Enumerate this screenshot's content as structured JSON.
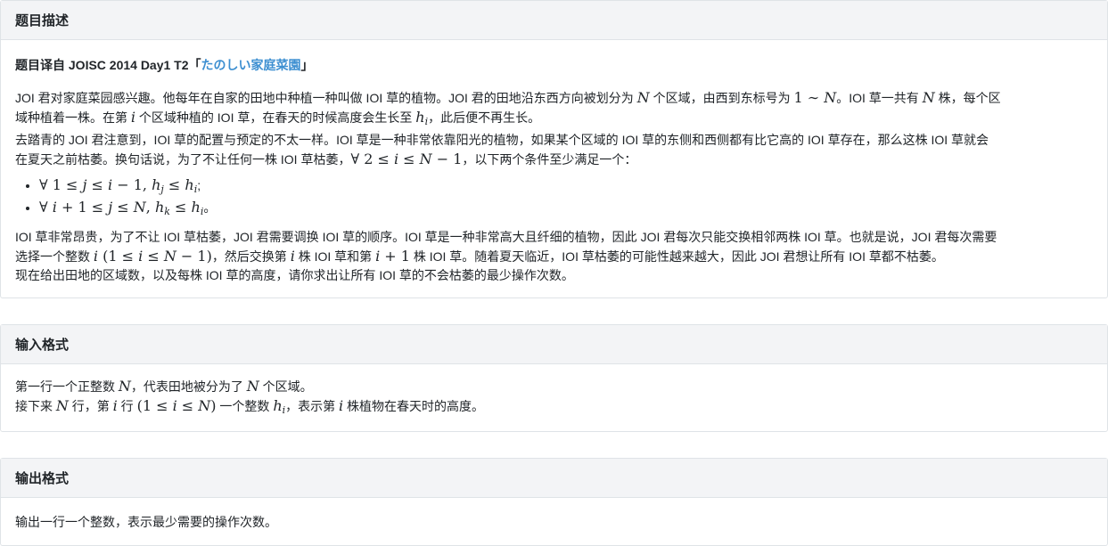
{
  "sections": {
    "description": {
      "title": "题目描述"
    },
    "input": {
      "title": "输入格式"
    },
    "output": {
      "title": "输出格式"
    }
  },
  "source": {
    "prefix": "题目译自 JOISC 2014 Day1 T2「",
    "link": "たのしい家庭菜園",
    "suffix": "」"
  },
  "desc": {
    "p1a": "JOI 君对家庭菜园感兴趣。他每年在自家的田地中种植一种叫做 IOI 草的植物。JOI 君的田地沿东西方向被划分为 ",
    "p1b": " 个区域，由西到东标号为 ",
    "p1c": "。IOI 草一共有 ",
    "p1d": " 株，每个区",
    "p2a": "域种植着一株。在第 ",
    "p2b": " 个区域种植的 IOI 草，在春天的时候高度会生长至 ",
    "p2c": "，此后便不再生长。",
    "p3": "去踏青的 JOI 君注意到，IOI 草的配置与预定的不太一样。IOI 草是一种非常依靠阳光的植物，如果某个区域的 IOI 草的东侧和西侧都有比它高的 IOI 草存在，那么这株 IOI 草就会",
    "p4a": "在夏天之前枯萎。换句话说，为了不让任何一株 IOI 草枯萎，",
    "p4b": "，以下两个条件至少满足一个：",
    "p5a": "IOI 草非常昂贵，为了不让 IOI 草枯萎，JOI 君需要调换 IOI 草的顺序。IOI 草是一种非常高大且纤细的植物，因此 JOI 君每次只能交换相邻两株 IOI 草。也就是说，JOI 君每次需要",
    "p6a": "选择一个整数 ",
    "p6b": "，然后交换第 ",
    "p6c": " 株 IOI 草和第 ",
    "p6d": " 株 IOI 草。随着夏天临近，IOI 草枯萎的可能性越来越大，因此 JOI 君想让所有 IOI 草都不枯萎。",
    "p7": "现在给出田地的区域数，以及每株 IOI 草的高度，请你求出让所有 IOI 草的不会枯萎的最少操作次数。"
  },
  "input": {
    "l1a": "第一行一个正整数 ",
    "l1b": "，代表田地被分为了 ",
    "l1c": " 个区域。",
    "l2a": "接下来 ",
    "l2b": " 行，第 ",
    "l2c": " 行 ",
    "l2d": " 一个整数 ",
    "l2e": "，表示第 ",
    "l2f": " 株植物在春天时的高度。"
  },
  "output": {
    "l1": "输出一行一个整数，表示最少需要的操作次数。"
  }
}
